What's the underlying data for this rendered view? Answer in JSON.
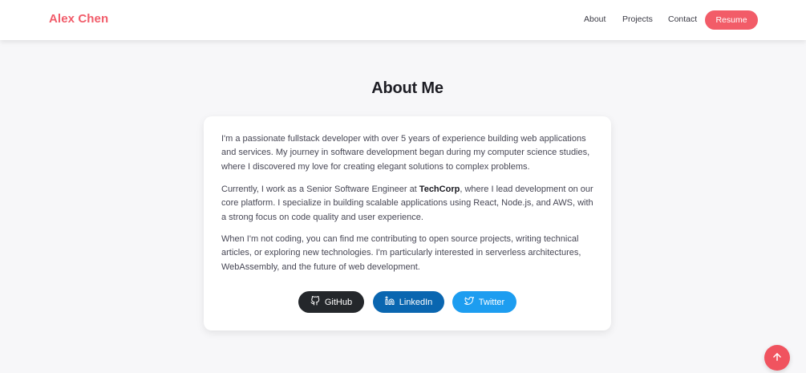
{
  "header": {
    "brand": "Alex Chen",
    "nav": [
      {
        "label": "About"
      },
      {
        "label": "Projects"
      },
      {
        "label": "Contact"
      }
    ],
    "resume_label": "Resume"
  },
  "about": {
    "title": "About Me",
    "p1": "I'm a passionate fullstack developer with over 5 years of experience building web applications and services. My journey in software development began during my computer science studies, where I discovered my love for creating elegant solutions to complex problems.",
    "p2_before": "Currently, I work as a Senior Software Engineer at ",
    "p2_company": "TechCorp",
    "p2_after": ", where I lead development on our core platform. I specialize in building scalable applications using React, Node.js, and AWS, with a strong focus on code quality and user experience.",
    "p3": "When I'm not coding, you can find me contributing to open source projects, writing technical articles, or exploring new technologies. I'm particularly interested in serverless architectures, WebAssembly, and the future of web development."
  },
  "social": [
    {
      "label": "GitHub",
      "icon": "github-icon",
      "color": "#24272b"
    },
    {
      "label": "LinkedIn",
      "icon": "linkedin-icon",
      "color": "#0a66b0"
    },
    {
      "label": "Twitter",
      "icon": "twitter-icon",
      "color": "#1d9df0"
    }
  ],
  "colors": {
    "accent": "#f25c68",
    "brand_text": "#f15c6a",
    "background": "#f7f7f9"
  },
  "scroll_top": {
    "icon": "arrow-up-icon"
  }
}
